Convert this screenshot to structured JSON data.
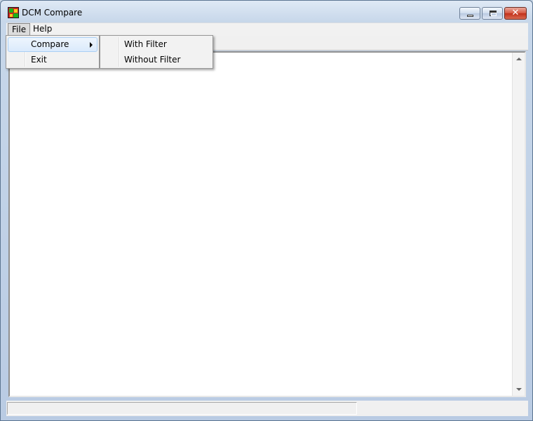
{
  "window": {
    "title": "DCM Compare",
    "icon": "dcm-compare-app-icon"
  },
  "controls": {
    "minimize_icon": "minimize-icon",
    "maximize_icon": "maximize-icon",
    "close_icon": "close-icon",
    "close_glyph": "✕"
  },
  "menubar": {
    "items": [
      {
        "label": "File"
      },
      {
        "label": "Help"
      }
    ]
  },
  "file_menu": {
    "items": [
      {
        "label": "Compare",
        "has_submenu": true
      },
      {
        "label": "Exit"
      }
    ]
  },
  "compare_submenu": {
    "items": [
      {
        "label": "With Filter"
      },
      {
        "label": "Without Filter"
      }
    ]
  },
  "statusbar": {
    "panes": [
      "",
      ""
    ]
  },
  "colors": {
    "titlebar": "#c7d7ea",
    "close_button": "#c1301a",
    "menu_highlight": "#dbeafc"
  }
}
